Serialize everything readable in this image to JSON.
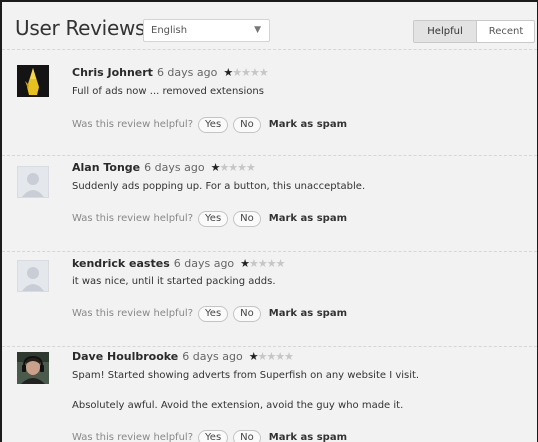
{
  "header": {
    "title": "User Reviews",
    "language_select": {
      "value": "English"
    },
    "sort_tabs": [
      {
        "label": "Helpful",
        "active": true
      },
      {
        "label": "Recent",
        "active": false
      }
    ]
  },
  "colors": {
    "background": "#f2f2f2",
    "frame": "#1c1c1c",
    "star_filled": "#222222",
    "star_empty": "#c6c6c6",
    "active_tab": "#e3e3e3"
  },
  "helpful_prompt": "Was this review helpful?",
  "yes_label": "Yes",
  "no_label": "No",
  "spam_label": "Mark as spam",
  "reviews": [
    {
      "author": "Chris Johnert",
      "time": "6 days ago",
      "rating": 1,
      "max_rating": 5,
      "avatar": "yellow-figure-avatar",
      "lines": [
        "Full of ads now ... removed extensions"
      ]
    },
    {
      "author": "Alan Tonge",
      "time": "6 days ago",
      "rating": 1,
      "max_rating": 5,
      "avatar": "default-avatar",
      "lines": [
        "Suddenly ads popping up. For a button, this unacceptable."
      ]
    },
    {
      "author": "kendrick eastes",
      "time": "6 days ago",
      "rating": 1,
      "max_rating": 5,
      "avatar": "default-avatar",
      "lines": [
        "it was nice, until it started packing adds."
      ]
    },
    {
      "author": "Dave Houlbrooke",
      "time": "6 days ago",
      "rating": 1,
      "max_rating": 5,
      "avatar": "headset-user-avatar",
      "lines": [
        "Spam! Started showing adverts from Superfish on any website I visit.",
        "Absolutely awful. Avoid the extension, avoid the guy who made it."
      ]
    }
  ]
}
